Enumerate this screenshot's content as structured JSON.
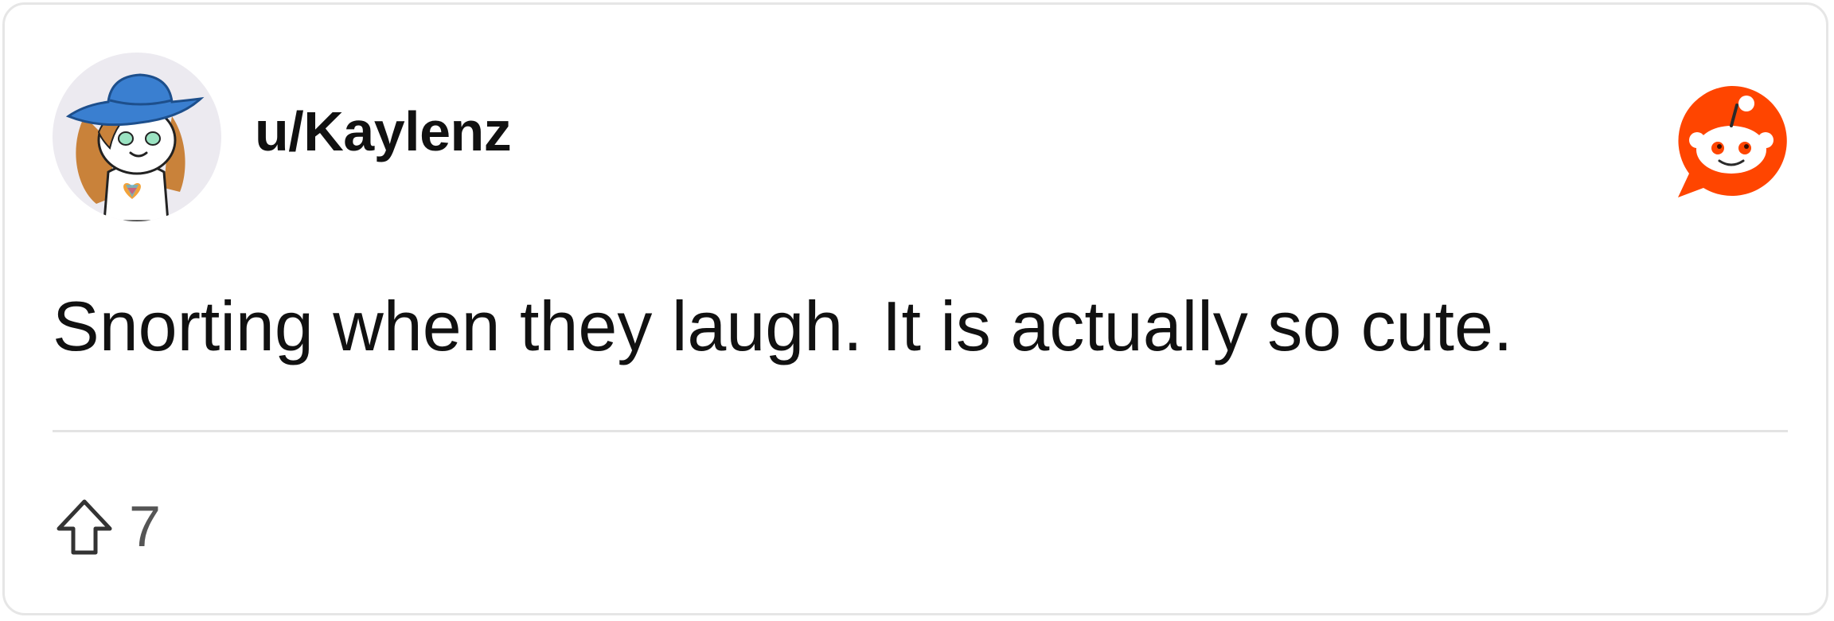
{
  "comment": {
    "username": "u/Kaylenz",
    "text": "Snorting when they laugh. It is actually so cute.",
    "upvote_count": "7"
  },
  "icons": {
    "avatar": "snoo-avatar-blue-hat",
    "logo": "reddit-logo-icon",
    "vote": "upvote-arrow-icon"
  },
  "colors": {
    "reddit_orange": "#ff4500",
    "avatar_hat": "#3a7fd0",
    "avatar_hair": "#c9823a",
    "divider": "#e3e3e3"
  }
}
